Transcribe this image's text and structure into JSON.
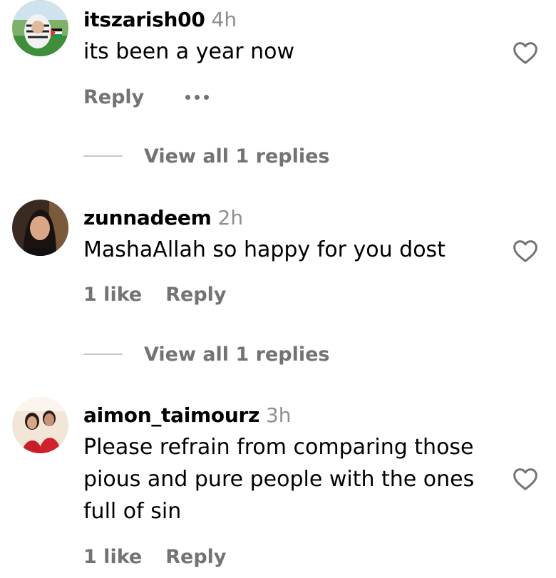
{
  "comments": [
    {
      "username": "itszarish00",
      "time": "4h",
      "text": "its been a year now",
      "reply_label": "Reply",
      "more_icon": "more-dots-icon",
      "view_replies": "View all 1 replies"
    },
    {
      "username": "zunnadeem",
      "time": "2h",
      "text": "MashaAllah so happy for you dost",
      "likes": "1 like",
      "reply_label": "Reply",
      "view_replies": "View all 1 replies"
    },
    {
      "username": "aimon_taimourz",
      "time": "3h",
      "text": "Please refrain from comparing those pious and pure people with the ones full of sin",
      "likes": "1 like",
      "reply_label": "Reply"
    }
  ],
  "icons": {
    "like": "heart-outline-icon"
  },
  "colors": {
    "secondary_text": "#737373",
    "time_text": "#8e8e8e",
    "divider": "#c7c7c7"
  }
}
